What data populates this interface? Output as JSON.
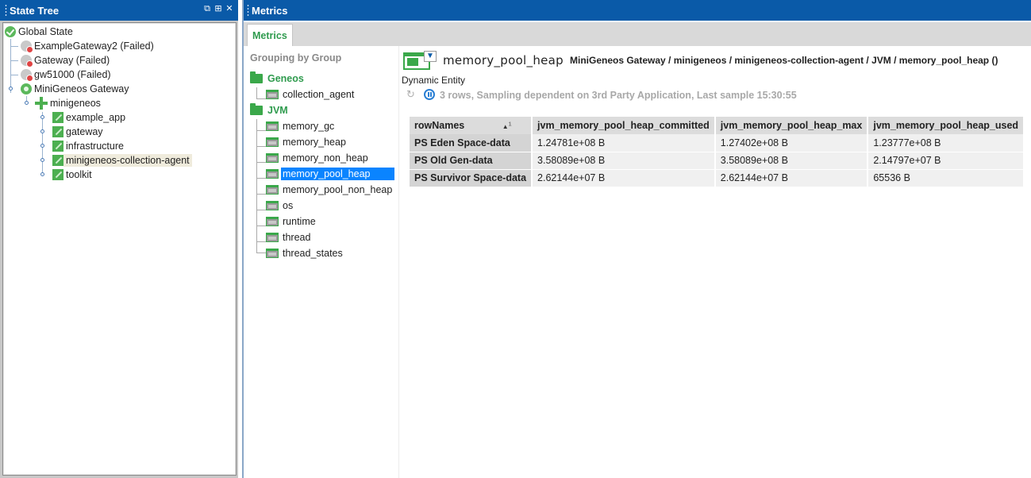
{
  "state_tree": {
    "title": "State Tree",
    "controls": [
      "⧉",
      "⊞",
      "✕"
    ],
    "nodes": [
      {
        "label": "Global State",
        "icon": "ok"
      },
      {
        "label": "ExampleGateway2 (Failed)",
        "icon": "failed"
      },
      {
        "label": "Gateway (Failed)",
        "icon": "failed"
      },
      {
        "label": "gw51000 (Failed)",
        "icon": "failed"
      },
      {
        "label": "MiniGeneos Gateway",
        "icon": "gateway"
      },
      {
        "label": "minigeneos",
        "icon": "probe"
      },
      {
        "label": "example_app",
        "icon": "entity"
      },
      {
        "label": "gateway",
        "icon": "entity"
      },
      {
        "label": "infrastructure",
        "icon": "entity"
      },
      {
        "label": "minigeneos-collection-agent",
        "icon": "entity",
        "selected": true
      },
      {
        "label": "toolkit",
        "icon": "entity"
      }
    ]
  },
  "metrics": {
    "title": "Metrics",
    "tab_label": "Metrics",
    "grouping_title": "Grouping by Group",
    "groups": [
      {
        "label": "Geneos",
        "items": [
          "collection_agent"
        ]
      },
      {
        "label": "JVM",
        "items": [
          "memory_gc",
          "memory_heap",
          "memory_non_heap",
          "memory_pool_heap",
          "memory_pool_non_heap",
          "os",
          "runtime",
          "thread",
          "thread_states"
        ]
      }
    ],
    "selected_item": "memory_pool_heap",
    "dataview": {
      "name": "memory_pool_heap",
      "path": "MiniGeneos Gateway / minigeneos / minigeneos-collection-agent / JVM / memory_pool_heap ()",
      "entity_type": "Dynamic Entity",
      "sample_info": "3 rows, Sampling dependent on 3rd Party Application, Last sample 15:30:55",
      "filter_icon": "filter-icon",
      "refresh_icon": "refresh-icon",
      "pause_icon": "pause-icon"
    },
    "table": {
      "columns": [
        "rowNames",
        "jvm_memory_pool_heap_committed",
        "jvm_memory_pool_heap_max",
        "jvm_memory_pool_heap_used"
      ],
      "sort_indicator": "1",
      "rows": [
        [
          "PS Eden Space-data",
          "1.24781e+08 B",
          "1.27402e+08 B",
          "1.23777e+08 B"
        ],
        [
          "PS Old Gen-data",
          "3.58089e+08 B",
          "3.58089e+08 B",
          "2.14797e+07 B"
        ],
        [
          "PS Survivor Space-data",
          "2.62144e+07 B",
          "2.62144e+07 B",
          "65536 B"
        ]
      ]
    }
  }
}
